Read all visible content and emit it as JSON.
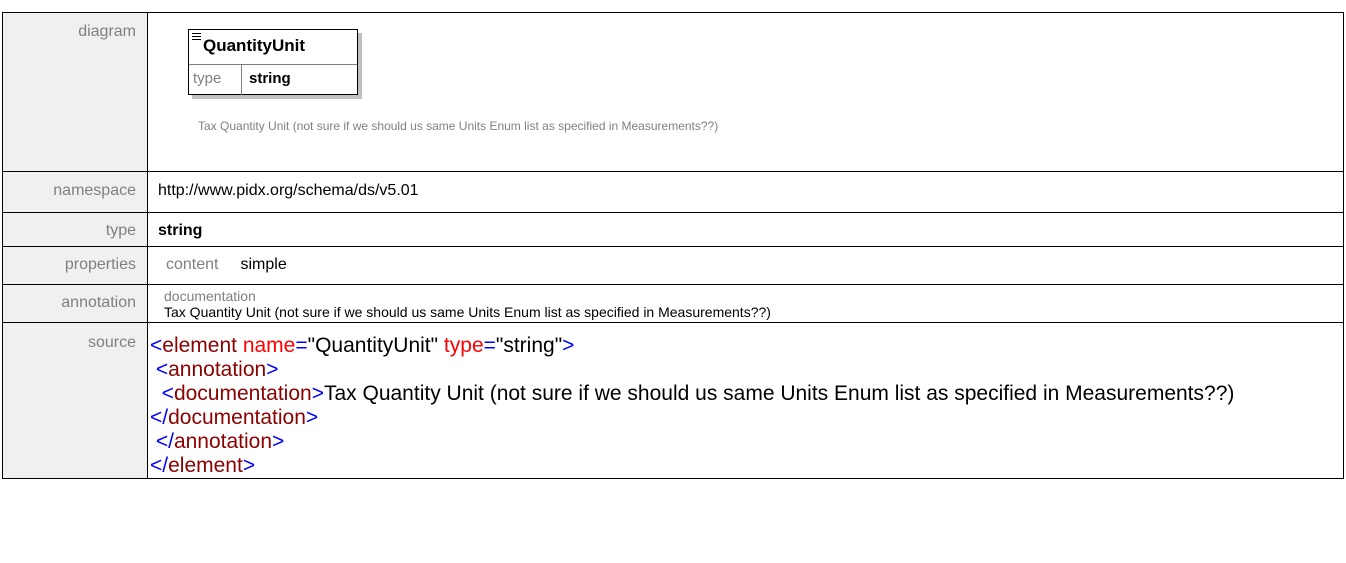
{
  "labels": {
    "diagram": "diagram",
    "namespace": "namespace",
    "type": "type",
    "properties": "properties",
    "annotation": "annotation",
    "source": "source"
  },
  "diagram": {
    "element_name": "QuantityUnit",
    "type_key": "type",
    "type_value": "string",
    "documentation": "Tax Quantity Unit (not sure if we should us same Units Enum list as specified in Measurements??)"
  },
  "namespace": "http://www.pidx.org/schema/ds/v5.01",
  "type": "string",
  "properties": {
    "key": "content",
    "value": "simple"
  },
  "annotation": {
    "key": "documentation",
    "value": "Tax Quantity Unit (not sure if we should us same Units Enum list as specified in Measurements??)"
  },
  "source": {
    "l1_open": "<",
    "l1_tag": "element",
    "l1_attr1": " name",
    "l1_eq1": "=",
    "l1_val1": "\"QuantityUnit\"",
    "l1_attr2": " type",
    "l1_eq2": "=",
    "l1_val2": "\"string\"",
    "l1_close": ">",
    "l2_indent": " ",
    "l2_open": "<",
    "l2_tag": "annotation",
    "l2_close": ">",
    "l3_indent": "  ",
    "l3_open": "<",
    "l3_tag": "documentation",
    "l3_close": ">",
    "l3_text": "Tax Quantity Unit (not sure if we should us same Units Enum list as specified in Measurements??)",
    "l3_end_open": "</",
    "l3_end_tag": "documentation",
    "l3_end_close": ">",
    "l4_indent": " ",
    "l4_open": "</",
    "l4_tag": "annotation",
    "l4_close": ">",
    "l5_open": "</",
    "l5_tag": "element",
    "l5_close": ">"
  },
  "colors": {
    "label_bg": "#f0f0f0",
    "label_text": "#808080",
    "xml_tag": "#8b0000",
    "xml_punct": "#0000ff",
    "xml_attr": "#ff0000"
  }
}
